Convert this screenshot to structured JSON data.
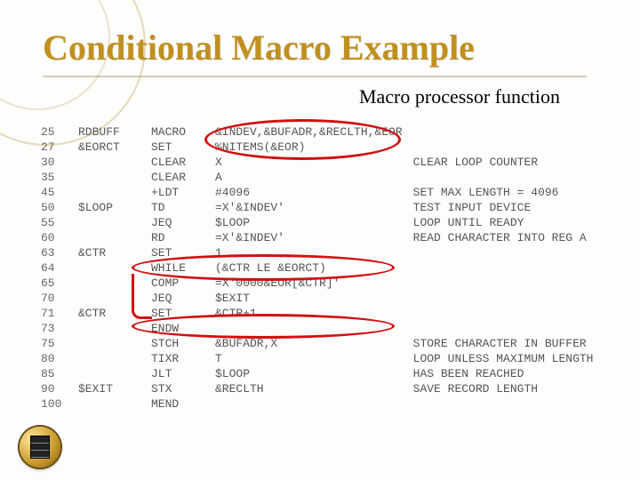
{
  "title": "Conditional Macro Example",
  "subtitle": "Macro processor function",
  "highlights": {
    "h1": "Macro header parameters and %NITEMS call",
    "h2": "WHILE loop condition",
    "h3": "ENDW terminator"
  },
  "logo_name": "institution-seal",
  "code": {
    "rows": [
      {
        "ln": "25",
        "lbl": "RDBUFF",
        "op": "MACRO",
        "arg": "&INDEV,&BUFADR,&RECLTH,&EOR",
        "cmt": ""
      },
      {
        "ln": "27",
        "lbl": "&EORCT",
        "op": "SET",
        "arg": "%NITEMS(&EOR)",
        "cmt": ""
      },
      {
        "ln": "30",
        "lbl": "",
        "op": "CLEAR",
        "arg": "X",
        "cmt": "CLEAR LOOP COUNTER"
      },
      {
        "ln": "35",
        "lbl": "",
        "op": "CLEAR",
        "arg": "A",
        "cmt": ""
      },
      {
        "ln": "45",
        "lbl": "",
        "op": "+LDT",
        "arg": "#4096",
        "cmt": "SET MAX LENGTH = 4096"
      },
      {
        "ln": "50",
        "lbl": "$LOOP",
        "op": "TD",
        "arg": "=X'&INDEV'",
        "cmt": "TEST INPUT DEVICE"
      },
      {
        "ln": "55",
        "lbl": "",
        "op": "JEQ",
        "arg": "$LOOP",
        "cmt": "LOOP UNTIL READY"
      },
      {
        "ln": "60",
        "lbl": "",
        "op": "RD",
        "arg": "=X'&INDEV'",
        "cmt": "READ CHARACTER INTO REG A"
      },
      {
        "ln": "63",
        "lbl": "&CTR",
        "op": "SET",
        "arg": "1",
        "cmt": ""
      },
      {
        "ln": "64",
        "lbl": "",
        "op": "WHILE",
        "arg": "(&CTR LE &EORCT)",
        "cmt": ""
      },
      {
        "ln": "65",
        "lbl": "",
        "op": "COMP",
        "arg": "=X'0000&EOR[&CTR]'",
        "cmt": ""
      },
      {
        "ln": "70",
        "lbl": "",
        "op": "JEQ",
        "arg": "$EXIT",
        "cmt": ""
      },
      {
        "ln": "71",
        "lbl": "&CTR",
        "op": "SET",
        "arg": "&CTR+1",
        "cmt": ""
      },
      {
        "ln": "73",
        "lbl": "",
        "op": "ENDW",
        "arg": "",
        "cmt": ""
      },
      {
        "ln": "75",
        "lbl": "",
        "op": "STCH",
        "arg": "&BUFADR,X",
        "cmt": "STORE CHARACTER IN BUFFER"
      },
      {
        "ln": "80",
        "lbl": "",
        "op": "TIXR",
        "arg": "T",
        "cmt": "LOOP UNLESS MAXIMUM LENGTH"
      },
      {
        "ln": "85",
        "lbl": "",
        "op": "JLT",
        "arg": "$LOOP",
        "cmt": "   HAS BEEN REACHED"
      },
      {
        "ln": "90",
        "lbl": "$EXIT",
        "op": "STX",
        "arg": "&RECLTH",
        "cmt": "SAVE RECORD LENGTH"
      },
      {
        "ln": "100",
        "lbl": "",
        "op": "MEND",
        "arg": "",
        "cmt": ""
      }
    ]
  }
}
